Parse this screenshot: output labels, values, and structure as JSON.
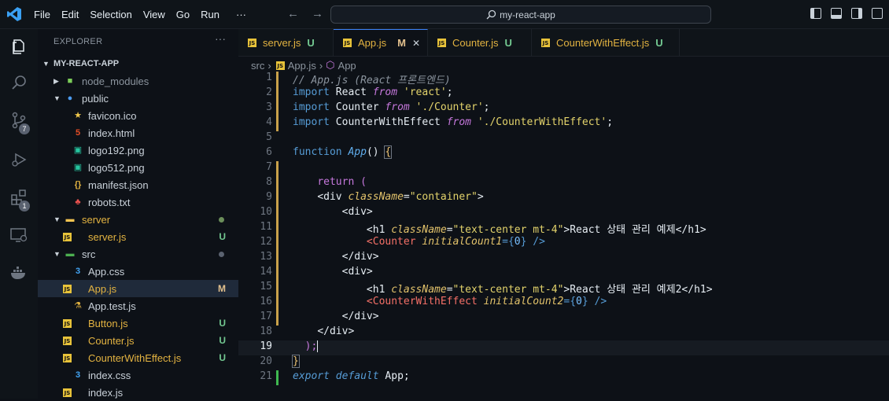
{
  "titlebar": {
    "menu": [
      "File",
      "Edit",
      "Selection",
      "View",
      "Go",
      "Run",
      "···"
    ],
    "search_text": "my-react-app"
  },
  "activity": {
    "source_control_badge": "7",
    "extensions_badge": "1"
  },
  "explorer": {
    "title": "EXPLORER",
    "more": "···",
    "root": "MY-REACT-APP",
    "items": [
      {
        "label": "node_modules",
        "icon": "folder-node-icon",
        "color": "#8b949e",
        "status": ""
      },
      {
        "label": "public",
        "icon": "folder-public-icon",
        "color": "#c9d1d9",
        "status": ""
      },
      {
        "label": "favicon.ico",
        "icon": "star-icon",
        "color": "#c9d1d9",
        "status": ""
      },
      {
        "label": "index.html",
        "icon": "html-icon",
        "color": "#c9d1d9",
        "status": ""
      },
      {
        "label": "logo192.png",
        "icon": "image-icon",
        "color": "#c9d1d9",
        "status": ""
      },
      {
        "label": "logo512.png",
        "icon": "image-icon",
        "color": "#c9d1d9",
        "status": ""
      },
      {
        "label": "manifest.json",
        "icon": "json-icon",
        "color": "#c9d1d9",
        "status": ""
      },
      {
        "label": "robots.txt",
        "icon": "robot-icon",
        "color": "#c9d1d9",
        "status": ""
      },
      {
        "label": "server",
        "icon": "folder-server-icon",
        "color": "#e3b341",
        "status": ""
      },
      {
        "label": "server.js",
        "icon": "js-icon",
        "color": "#e3b341",
        "status": "U"
      },
      {
        "label": "src",
        "icon": "folder-src-icon",
        "color": "#c9d1d9",
        "status": ""
      },
      {
        "label": "App.css",
        "icon": "css-icon",
        "color": "#c9d1d9",
        "status": ""
      },
      {
        "label": "App.js",
        "icon": "js-icon",
        "color": "#e3b341",
        "status": "M"
      },
      {
        "label": "App.test.js",
        "icon": "test-icon",
        "color": "#c9d1d9",
        "status": ""
      },
      {
        "label": "Button.js",
        "icon": "js-icon",
        "color": "#e3b341",
        "status": "U"
      },
      {
        "label": "Counter.js",
        "icon": "js-icon",
        "color": "#e3b341",
        "status": "U"
      },
      {
        "label": "CounterWithEffect.js",
        "icon": "js-icon",
        "color": "#e3b341",
        "status": "U"
      },
      {
        "label": "index.css",
        "icon": "css-icon",
        "color": "#c9d1d9",
        "status": ""
      },
      {
        "label": "index.js",
        "icon": "js-icon",
        "color": "#c9d1d9",
        "status": ""
      }
    ]
  },
  "tabs": [
    {
      "label": "server.js",
      "status": "U",
      "active": false
    },
    {
      "label": "App.js",
      "status": "M",
      "active": true,
      "close": "✕"
    },
    {
      "label": "Counter.js",
      "status": "U",
      "active": false
    },
    {
      "label": "CounterWithEffect.js",
      "status": "U",
      "active": false
    }
  ],
  "breadcrumb": [
    "src",
    "App.js",
    "App"
  ],
  "code": {
    "line_numbers": [
      "1",
      "2",
      "3",
      "4",
      "5",
      "6",
      "7",
      "8",
      "9",
      "10",
      "11",
      "12",
      "13",
      "14",
      "15",
      "16",
      "17",
      "18",
      "19",
      "20",
      "21"
    ],
    "current_line": "19",
    "l1": "// App.js (React 프론트엔드)",
    "l2_kw": "import",
    "l2_id": " React ",
    "l2_from": "from",
    "l2_str": " 'react'",
    "l2_end": ";",
    "l3_kw": "import",
    "l3_id": " Counter ",
    "l3_from": "from",
    "l3_str": " './Counter'",
    "l3_end": ";",
    "l4_kw": "import",
    "l4_id": " CounterWithEffect ",
    "l4_from": "from",
    "l4_str": " './CounterWithEffect'",
    "l4_end": ";",
    "l6_kw": "function",
    "l6_fn": " App",
    "l6_rest": "() ",
    "l6_brace": "{",
    "l8_kw": "return",
    "l8_rest": " (",
    "l9_open": "<div ",
    "l9_attr": "className",
    "l9_eq": "=",
    "l9_str": "\"container\"",
    "l9_close": ">",
    "l10": "<div>",
    "l11_open": "<h1 ",
    "l11_attr": "className",
    "l11_eq": "=",
    "l11_str": "\"text-center mt-4\"",
    "l11_text": ">React 상태 관리 예제</h1>",
    "l12_open": "<",
    "l12_comp": "Counter",
    "l12_attr": " initialCount1",
    "l12_eq": "={",
    "l12_num": "0",
    "l12_close": "} />",
    "l13": "</div>",
    "l14": "<div>",
    "l15_open": "<h1 ",
    "l15_attr": "className",
    "l15_eq": "=",
    "l15_str": "\"text-center mt-4\"",
    "l15_text": ">React 상태 관리 예제2</h1>",
    "l16_open": "<",
    "l16_comp": "CounterWithEffect",
    "l16_attr": " initialCount2",
    "l16_eq": "={",
    "l16_num": "0",
    "l16_close": "} />",
    "l17": "</div>",
    "l18": "</div>",
    "l19": ");",
    "l20": "}",
    "l21_kw": "export",
    "l21_kw2": " default",
    "l21_id": " App",
    "l21_end": ";"
  },
  "colors": {
    "accent": "#3b82f6",
    "untracked": "#73c991",
    "modified": "#e2c08d",
    "gutter_modified": "#c9a14a",
    "gutter_added": "#3fb950"
  }
}
